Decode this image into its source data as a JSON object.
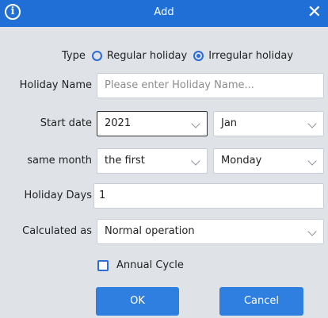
{
  "window": {
    "title": "Add",
    "info_icon": "info-icon",
    "close_icon": "close-icon",
    "close_glyph": "✕"
  },
  "form": {
    "type": {
      "label": "Type",
      "options": [
        "Regular holiday",
        "Irregular holiday"
      ],
      "selected": "Irregular holiday"
    },
    "holiday_name": {
      "label": "Holiday Name",
      "value": "",
      "placeholder": "Please enter Holiday Name..."
    },
    "start_date": {
      "label": "Start date",
      "year": "2021",
      "month": "Jan"
    },
    "same_month": {
      "label": "same month",
      "ordinal": "the first",
      "weekday": "Monday"
    },
    "holiday_days": {
      "label": "Holiday Days",
      "value": "1"
    },
    "calculated_as": {
      "label": "Calculated as",
      "value": "Normal operation"
    },
    "annual_cycle": {
      "label": "Annual Cycle",
      "checked": false
    }
  },
  "buttons": {
    "ok": "OK",
    "cancel": "Cancel"
  },
  "colors": {
    "titlebar": "#1f6fd6",
    "accent": "#2b6cd6",
    "button": "#2f7fe0",
    "background": "#dfe3e8"
  }
}
